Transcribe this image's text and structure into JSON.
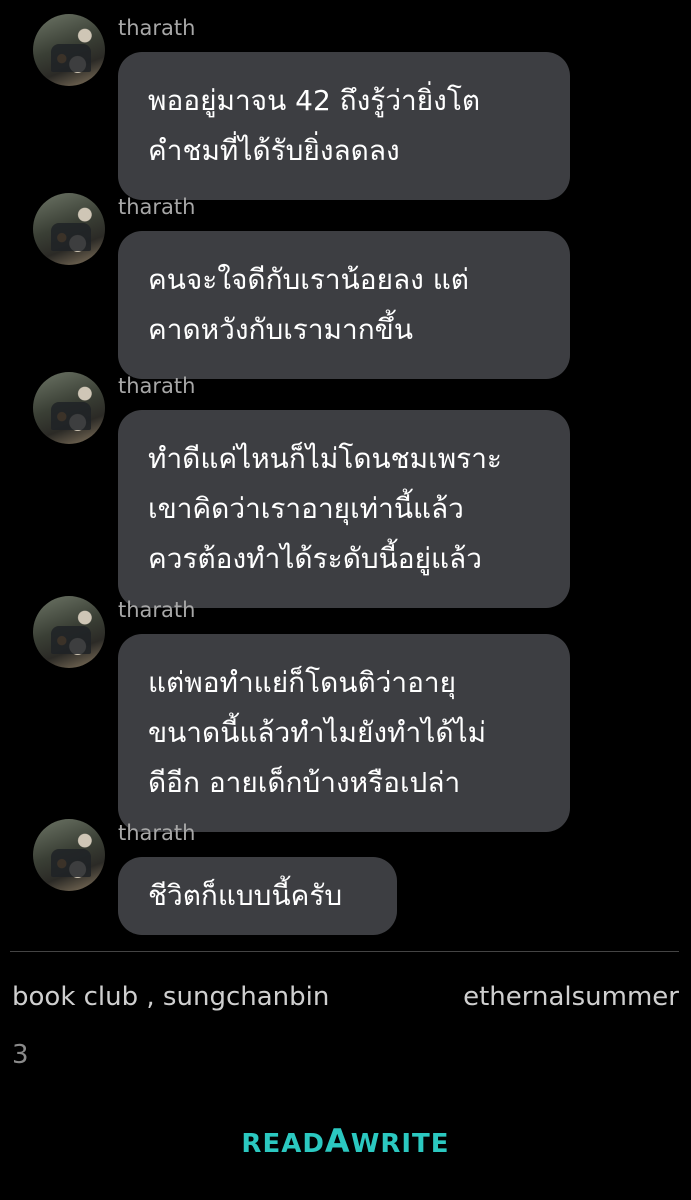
{
  "messages": [
    {
      "user": "tharath",
      "lines": [
        "พออยู่มาจน 42 ถึงรู้ว่ายิ่งโต",
        "คำชมที่ได้รับยิ่งลดลง"
      ]
    },
    {
      "user": "tharath",
      "lines": [
        "คนจะใจดีกับเราน้อยลง แต่",
        "คาดหวังกับเรามากขึ้น"
      ]
    },
    {
      "user": "tharath",
      "lines": [
        "ทำดีแค่ไหนก็ไม่โดนชมเพราะ",
        "เขาคิดว่าเราอายุเท่านี้แล้ว",
        "ควรต้องทำได้ระดับนี้อยู่แล้ว"
      ]
    },
    {
      "user": "tharath",
      "lines": [
        "แต่พอทำแย่ก็โดนติว่าอายุ",
        "ขนาดนี้แล้วทำไมยังทำได้ไม่",
        "ดีอีก อายเด็กบ้างหรือเปล่า"
      ]
    },
    {
      "user": "tharath",
      "lines": [
        "ชีวิตก็แบบนี้ครับ"
      ]
    }
  ],
  "footer": {
    "left_text": "book club , sungchanbin",
    "right_text": "ethernalsummer",
    "page_number": "3"
  },
  "logo": {
    "part1": "READ",
    "part2": "A",
    "part3": "WRITE",
    "color": "#2bc8c0"
  }
}
